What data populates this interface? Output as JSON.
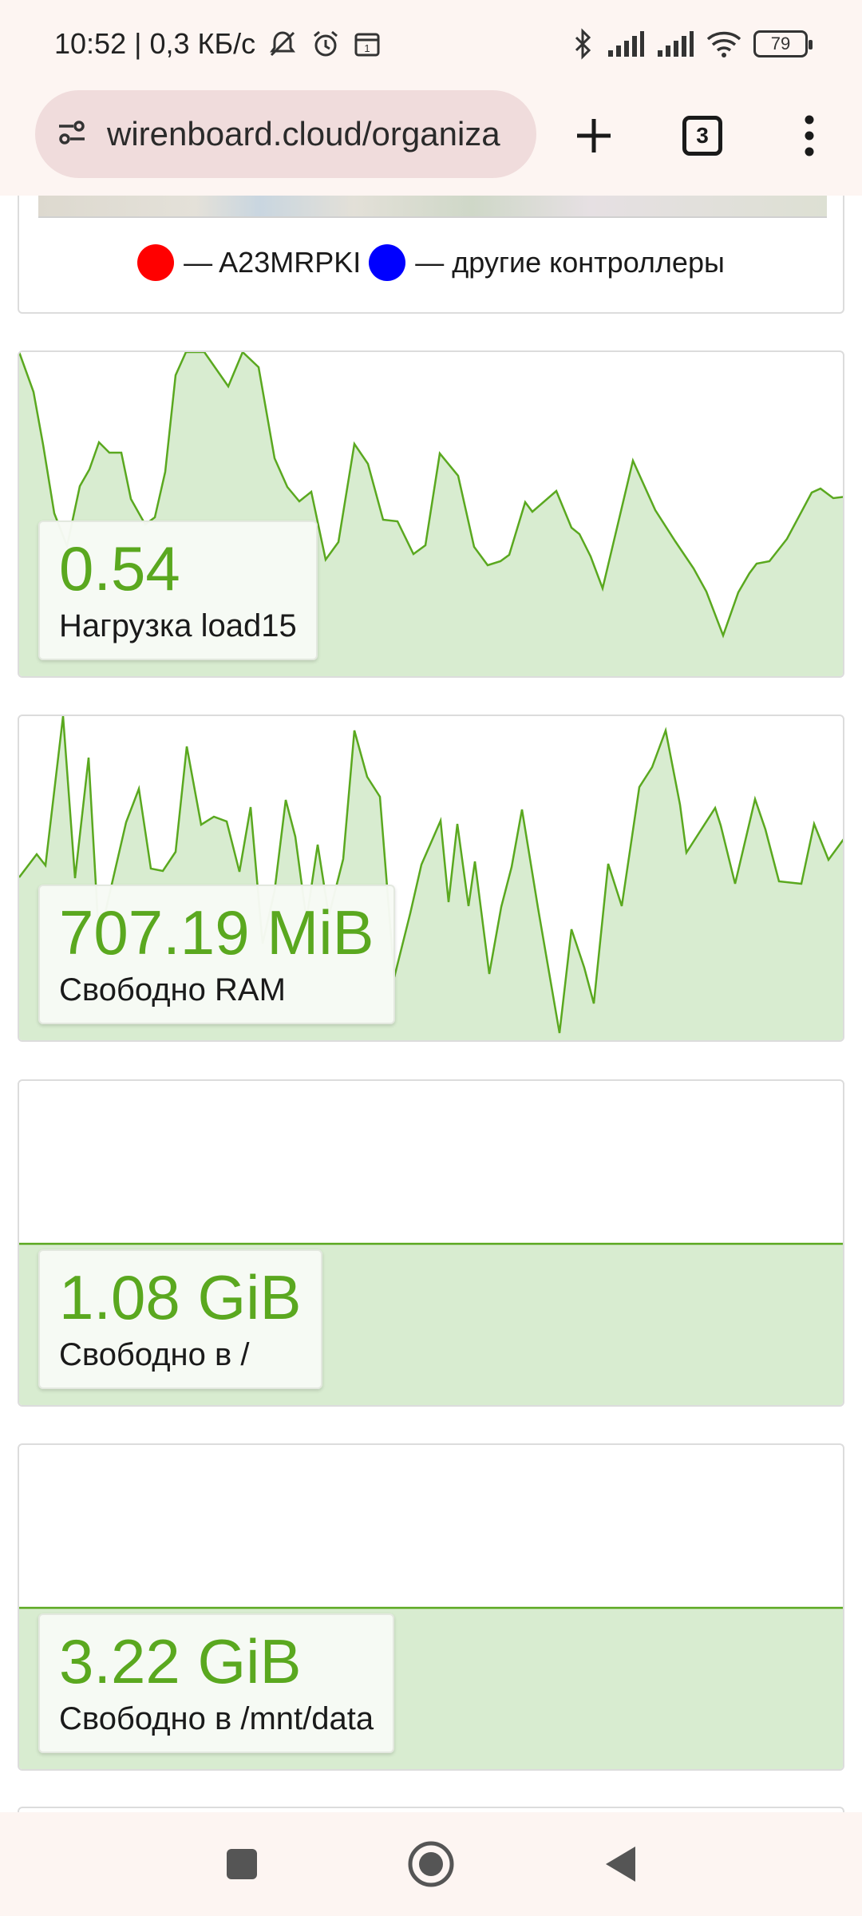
{
  "status_bar": {
    "time_speed": "10:52 | 0,3 КБ/с",
    "battery": "79"
  },
  "browser": {
    "url": "wirenboard.cloud/organiza",
    "tabs_count": "3"
  },
  "map_legend": {
    "items": [
      {
        "color": "#ff0000",
        "label": "— A23MRPKI"
      },
      {
        "color": "#0000ff",
        "label": "— другие контроллеры"
      }
    ]
  },
  "colors": {
    "accent_green": "#5aa81f",
    "fill_green": "#d8ecd0"
  },
  "metrics": [
    {
      "value": "0.54",
      "label": "Нагрузка load15"
    },
    {
      "value": "707.19 MiB",
      "label": "Свободно RAM"
    },
    {
      "value": "1.08 GiB",
      "label": "Свободно в /"
    },
    {
      "value": "3.22 GiB",
      "label": "Свободно в /mnt/data"
    }
  ]
}
